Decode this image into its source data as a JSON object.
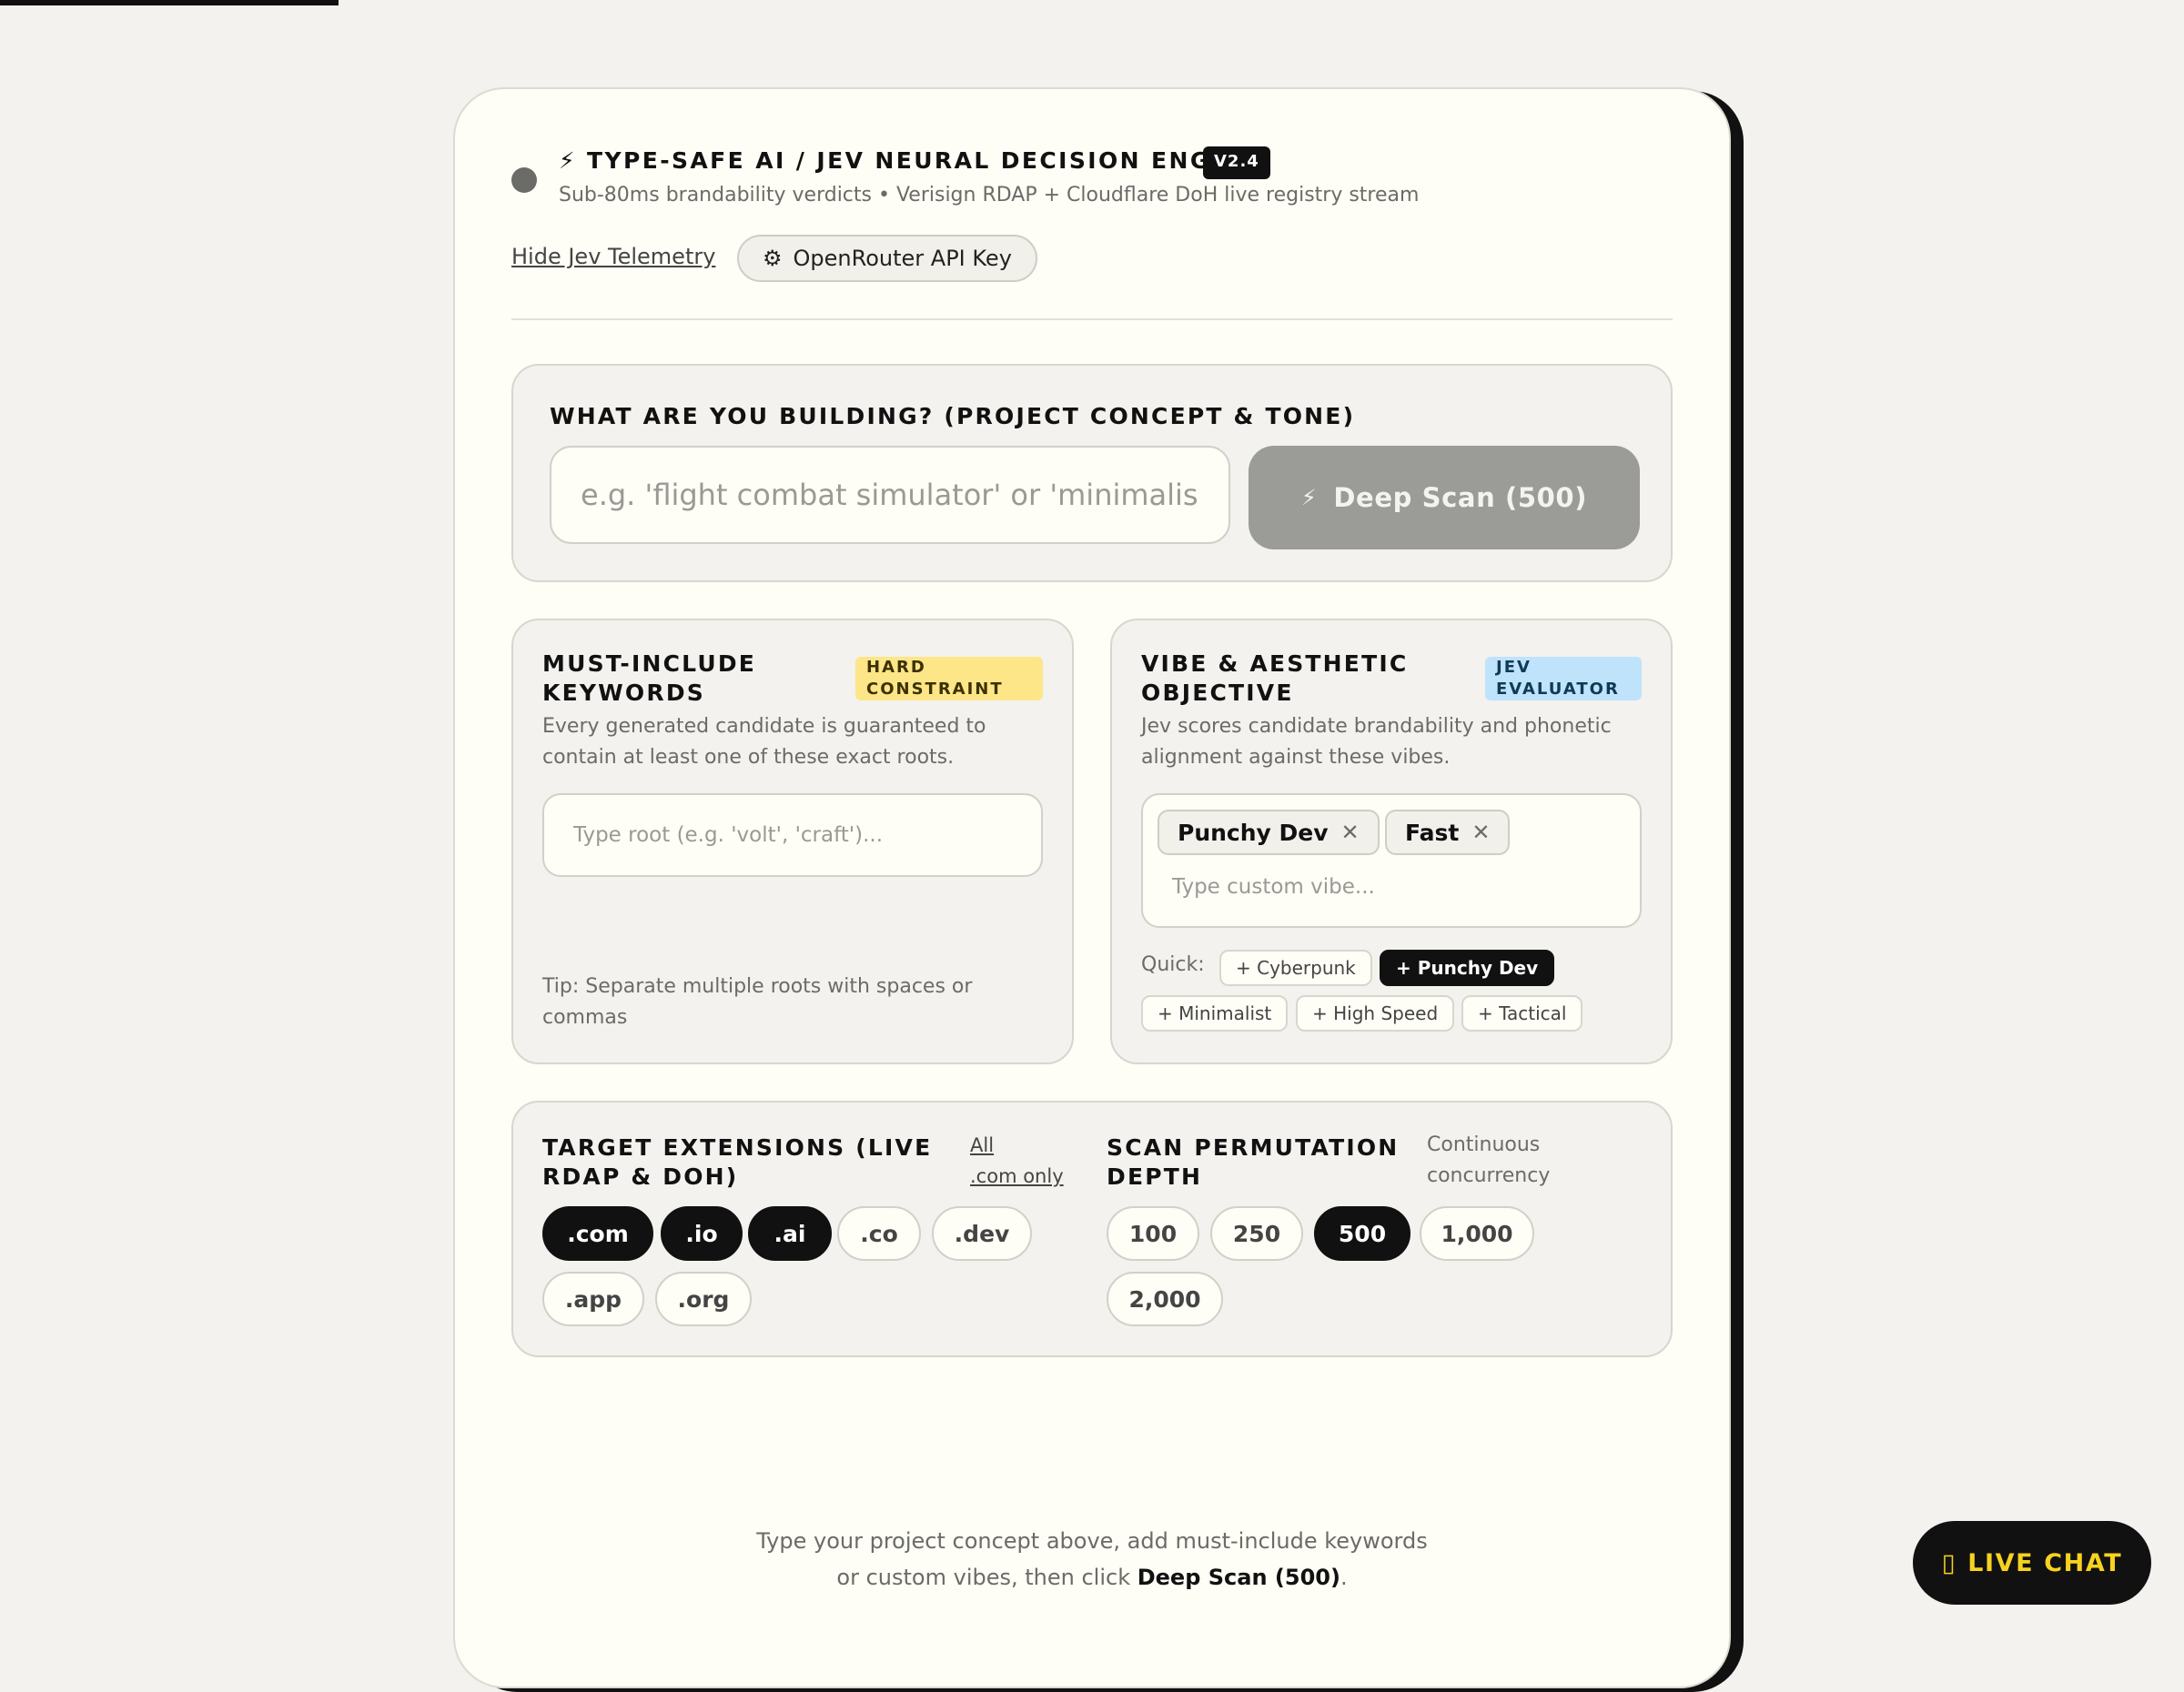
{
  "header": {
    "title": "⚡ TYPE-SAFE AI / JEV NEURAL DECISION ENGINE",
    "version": "V2.4",
    "subtitle": "Sub-80ms brandability verdicts • Verisign RDAP + Cloudflare DoH live registry stream",
    "telemetry_link": "Hide Jev Telemetry",
    "api_key_button": "OpenRouter API Key",
    "api_key_icon": "⚙"
  },
  "concept": {
    "heading": "WHAT ARE YOU BUILDING? (PROJECT CONCEPT & TONE)",
    "placeholder": "e.g. 'flight combat simulator' or 'minimalis",
    "scan_icon": "⚡",
    "scan_button": "Deep Scan (500)"
  },
  "keywords": {
    "heading_line1": "MUST-INCLUDE",
    "heading_line2": "KEYWORDS",
    "badge_line1": "HARD",
    "badge_line2": "CONSTRAINT",
    "desc_line1": "Every generated candidate is guaranteed to",
    "desc_line2": "contain at least one of these exact roots.",
    "placeholder": "Type root (e.g. 'volt', 'craft')...",
    "tip_line1": "Tip: Separate multiple roots with spaces or",
    "tip_line2": "commas"
  },
  "vibe": {
    "heading_line1": "VIBE & AESTHETIC",
    "heading_line2": "OBJECTIVE",
    "badge_line1": "JEV",
    "badge_line2": "EVALUATOR",
    "desc_line1": "Jev scores candidate brandability and phonetic",
    "desc_line2": "alignment against these vibes.",
    "chips": [
      "Punchy Dev",
      "Fast"
    ],
    "remove_glyph": "✕",
    "placeholder": "Type custom vibe...",
    "quick_label": "Quick:",
    "quick": [
      "+ Cyberpunk",
      "+ Punchy Dev",
      "+ Minimalist",
      "+ High Speed",
      "+ Tactical"
    ]
  },
  "extensions": {
    "heading_line1": "TARGET EXTENSIONS (LIVE",
    "heading_line2": "RDAP & DOH)",
    "all_link": "All",
    "com_only_link": ".com only",
    "items": [
      ".com",
      ".io",
      ".ai",
      ".co",
      ".dev",
      ".app",
      ".org"
    ]
  },
  "depth": {
    "heading_line1": "SCAN PERMUTATION",
    "heading_line2": "DEPTH",
    "note_line1": "Continuous",
    "note_line2": "concurrency",
    "options": [
      "100",
      "250",
      "500",
      "1,000",
      "2,000"
    ]
  },
  "footer": {
    "line1": "Type your project concept above, add must-include keywords",
    "line2_prefix": "or custom vibes, then click ",
    "line2_bold": "Deep Scan (500)",
    "line2_suffix": "."
  },
  "live_chat": {
    "icon": "▯",
    "label": "LIVE CHAT"
  },
  "colors": {
    "background": "#f3f2ee",
    "card": "#fefdf6",
    "accent_dark": "#111111",
    "hard_constraint": "#fde688",
    "jev_evaluator": "#bfe3fa",
    "live_chat_text": "#f7d21e"
  }
}
